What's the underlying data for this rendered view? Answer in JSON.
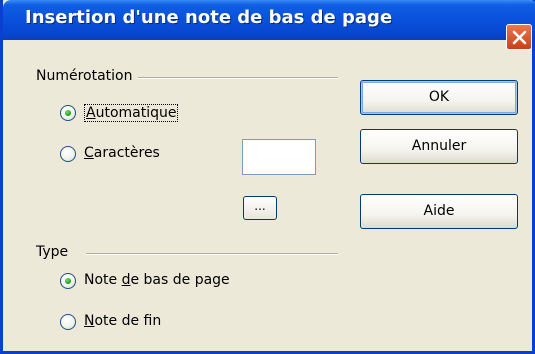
{
  "window": {
    "title": "Insertion d'une note de bas de page"
  },
  "numbering": {
    "group_label": "Numérotation",
    "options": [
      {
        "prefix": "",
        "mnemonic": "A",
        "rest": "utomatique",
        "selected": true
      },
      {
        "prefix": "",
        "mnemonic": "C",
        "rest": "aractères",
        "selected": false
      }
    ],
    "characters_value": "",
    "browse_label": "..."
  },
  "type": {
    "group_label": "Type",
    "options": [
      {
        "prefix": "Note ",
        "mnemonic": "d",
        "rest": "e bas de page",
        "selected": true
      },
      {
        "prefix": "",
        "mnemonic": "N",
        "rest": "ote de fin",
        "selected": false
      }
    ]
  },
  "buttons": {
    "ok": "OK",
    "cancel": "Annuler",
    "help": "Aide"
  },
  "colors": {
    "titlebar": "#0a52dc",
    "dialog_bg": "#ece9d8",
    "close": "#d9572f",
    "radio_selected": "#1a9a1a"
  }
}
